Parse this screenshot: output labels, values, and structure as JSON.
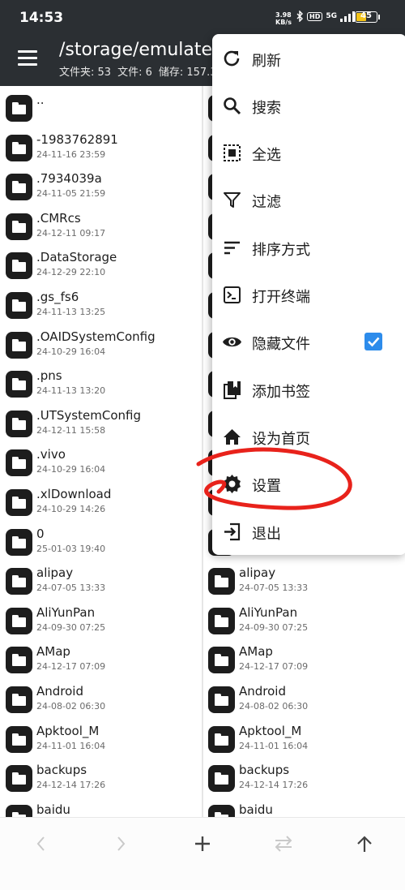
{
  "status_bar": {
    "time": "14:53",
    "net_speed_value": "3.98",
    "net_speed_unit": "KB/s",
    "hd_label": "HD",
    "network_label": "5G",
    "battery_level": "45",
    "battery_color": "#f2c318"
  },
  "app_bar": {
    "path": "/storage/emulated/0",
    "folders_label": "文件夹: 53",
    "files_label": "文件: 6",
    "storage_label": "储存: 157.3"
  },
  "left_pane": {
    "rows": [
      {
        "name": "..",
        "date": ""
      },
      {
        "name": "-1983762891",
        "date": "24-11-16 23:59"
      },
      {
        "name": ".7934039a",
        "date": "24-11-05 21:59"
      },
      {
        "name": ".CMRcs",
        "date": "24-12-11 09:17"
      },
      {
        "name": ".DataStorage",
        "date": "24-12-29 22:10"
      },
      {
        "name": ".gs_fs6",
        "date": "24-11-13 13:25"
      },
      {
        "name": ".OAIDSystemConfig",
        "date": "24-10-29 16:04"
      },
      {
        "name": ".pns",
        "date": "24-11-13 13:20"
      },
      {
        "name": ".UTSystemConfig",
        "date": "24-12-11 15:58"
      },
      {
        "name": ".vivo",
        "date": "24-10-29 16:04"
      },
      {
        "name": ".xlDownload",
        "date": "24-10-29 14:26"
      },
      {
        "name": "0",
        "date": "25-01-03 19:40"
      },
      {
        "name": "alipay",
        "date": "24-07-05 13:33"
      },
      {
        "name": "AliYunPan",
        "date": "24-09-30 07:25"
      },
      {
        "name": "AMap",
        "date": "24-12-17 07:09"
      },
      {
        "name": "Android",
        "date": "24-08-02 06:30"
      },
      {
        "name": "Apktool_M",
        "date": "24-11-01 16:04"
      },
      {
        "name": "backups",
        "date": "24-12-14 17:26"
      },
      {
        "name": "baidu",
        "date": ""
      }
    ]
  },
  "right_pane": {
    "rows": [
      {
        "name": "",
        "date": ""
      },
      {
        "name": "",
        "date": ""
      },
      {
        "name": "",
        "date": ""
      },
      {
        "name": "",
        "date": ""
      },
      {
        "name": "",
        "date": ""
      },
      {
        "name": "",
        "date": ""
      },
      {
        "name": "",
        "date": ""
      },
      {
        "name": "",
        "date": ""
      },
      {
        "name": "",
        "date": ""
      },
      {
        "name": "",
        "date": ""
      },
      {
        "name": "",
        "date": ""
      },
      {
        "name": "",
        "date": ""
      },
      {
        "name": "alipay",
        "date": "24-07-05 13:33"
      },
      {
        "name": "AliYunPan",
        "date": "24-09-30 07:25"
      },
      {
        "name": "AMap",
        "date": "24-12-17 07:09"
      },
      {
        "name": "Android",
        "date": "24-08-02 06:30"
      },
      {
        "name": "Apktool_M",
        "date": "24-11-01 16:04"
      },
      {
        "name": "backups",
        "date": "24-12-14 17:26"
      },
      {
        "name": "baidu",
        "date": ""
      }
    ]
  },
  "menu": {
    "items": [
      {
        "label": "刷新",
        "icon": "refresh-icon"
      },
      {
        "label": "搜索",
        "icon": "search-icon"
      },
      {
        "label": "全选",
        "icon": "select-all-icon"
      },
      {
        "label": "过滤",
        "icon": "filter-icon"
      },
      {
        "label": "排序方式",
        "icon": "sort-icon"
      },
      {
        "label": "打开终端",
        "icon": "terminal-icon"
      },
      {
        "label": "隐藏文件",
        "icon": "eye-icon",
        "checked": true
      },
      {
        "label": "添加书签",
        "icon": "bookmark-icon"
      },
      {
        "label": "设为首页",
        "icon": "home-icon"
      },
      {
        "label": "设置",
        "icon": "gear-icon"
      },
      {
        "label": "退出",
        "icon": "exit-icon"
      }
    ],
    "checkbox_color": "#2d8ceb"
  },
  "bottom_nav": {
    "back_icon": "chevron-left-icon",
    "forward_icon": "chevron-right-icon",
    "add_icon": "plus-icon",
    "swap_icon": "swap-icon",
    "up_icon": "arrow-up-icon"
  },
  "annotation": {
    "color": "#e8221b",
    "target": "设置"
  }
}
